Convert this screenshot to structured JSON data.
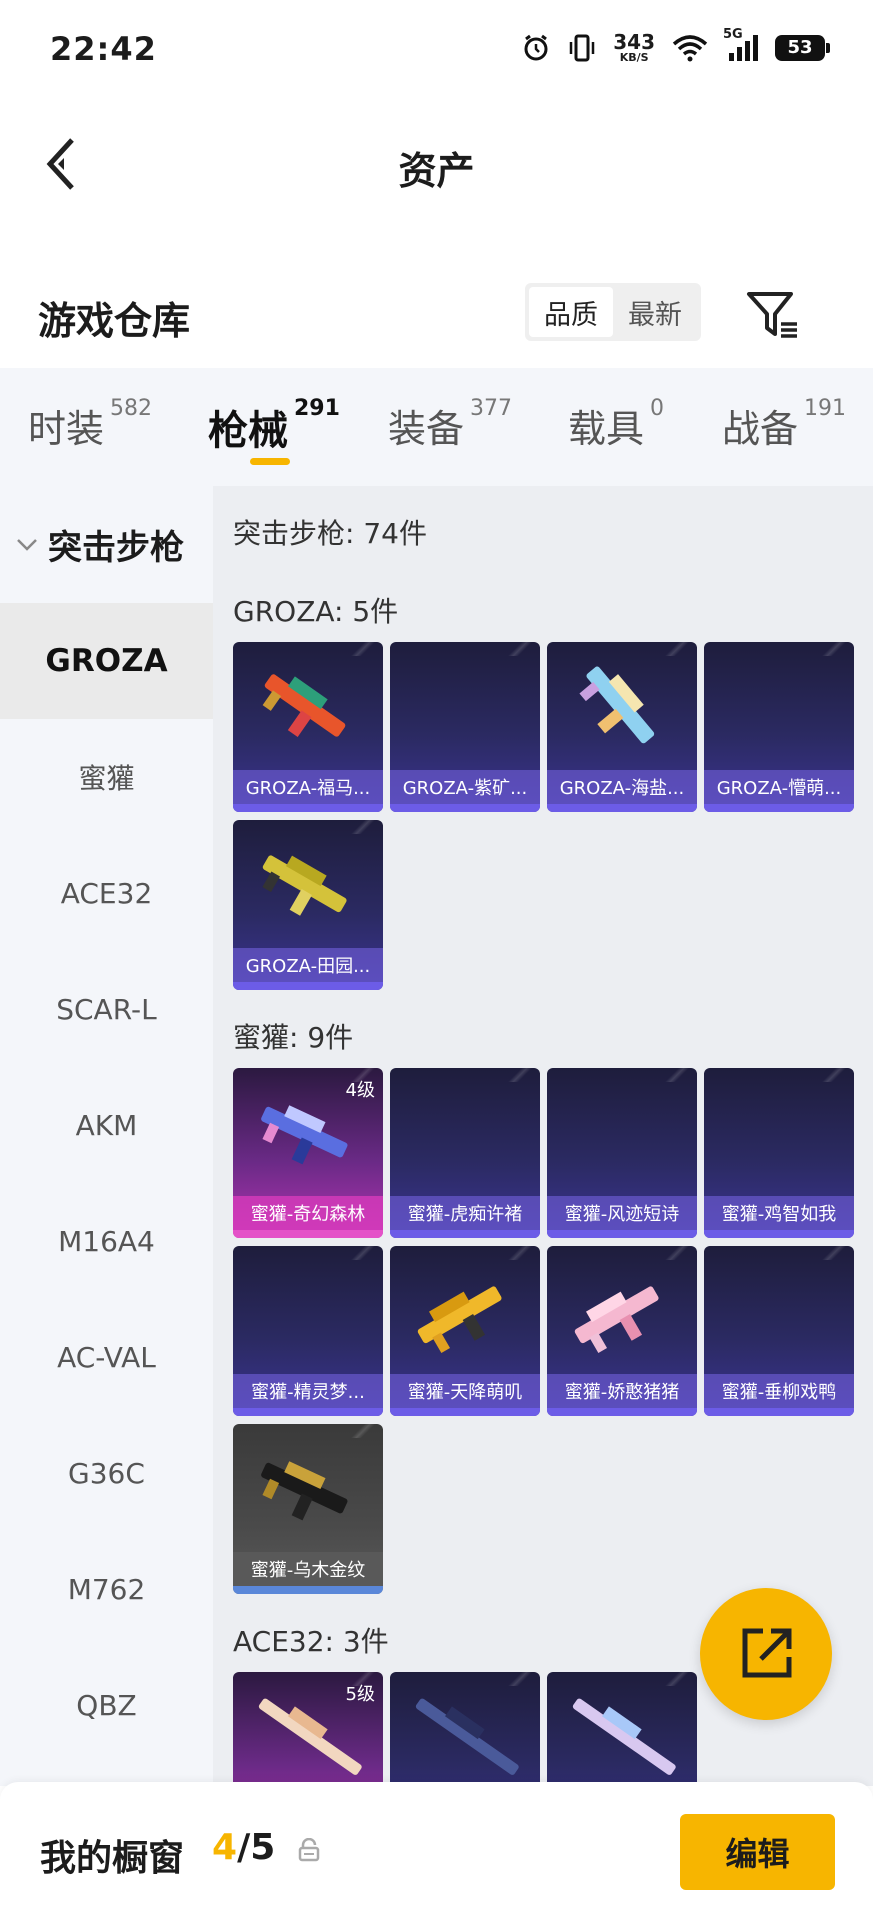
{
  "status_bar": {
    "time": "22:42",
    "net_speed": "343",
    "net_unit": "KB/S",
    "network_type": "5G",
    "battery": "53",
    "icons": [
      "alarm-icon",
      "vibrate-icon",
      "wifi-icon",
      "signal-icon",
      "battery-icon"
    ]
  },
  "header": {
    "title": "资产",
    "back_icon": "chevron-left-icon"
  },
  "warehouse": {
    "title": "游戏仓库",
    "sort_options": [
      "品质",
      "最新"
    ],
    "active_sort": "品质",
    "filter_icon": "filter-icon"
  },
  "category_tabs": [
    {
      "label": "时装",
      "count": "582"
    },
    {
      "label": "枪械",
      "count": "291",
      "active": true
    },
    {
      "label": "装备",
      "count": "377"
    },
    {
      "label": "载具",
      "count": "0"
    },
    {
      "label": "战备",
      "count": "191"
    }
  ],
  "left_nav": {
    "header": "突击步枪",
    "items": [
      "GROZA",
      "蜜獾",
      "ACE32",
      "SCAR-L",
      "AKM",
      "M16A4",
      "AC-VAL",
      "G36C",
      "M762",
      "QBZ"
    ],
    "active": "GROZA"
  },
  "content": {
    "summary": "突击步枪: 74件",
    "sections": [
      {
        "title": "GROZA: 5件",
        "cards": [
          {
            "label": "GROZA-福马...",
            "level": "",
            "rarity": "purple"
          },
          {
            "label": "GROZA-紫矿...",
            "level": "",
            "rarity": "purple"
          },
          {
            "label": "GROZA-海盐...",
            "level": "",
            "rarity": "purple"
          },
          {
            "label": "GROZA-懵萌...",
            "level": "",
            "rarity": "purple"
          },
          {
            "label": "GROZA-田园...",
            "level": "",
            "rarity": "purple"
          }
        ]
      },
      {
        "title": "蜜獾: 9件",
        "cards": [
          {
            "label": "蜜獾-奇幻森林",
            "level": "4级",
            "rarity": "pink"
          },
          {
            "label": "蜜獾-虎痴许褚",
            "level": "",
            "rarity": "purple"
          },
          {
            "label": "蜜獾-风迹短诗",
            "level": "",
            "rarity": "purple"
          },
          {
            "label": "蜜獾-鸡智如我",
            "level": "",
            "rarity": "purple"
          },
          {
            "label": "蜜獾-精灵梦...",
            "level": "",
            "rarity": "purple"
          },
          {
            "label": "蜜獾-天降萌叽",
            "level": "",
            "rarity": "purple"
          },
          {
            "label": "蜜獾-娇憨猪猪",
            "level": "",
            "rarity": "purple"
          },
          {
            "label": "蜜獾-垂柳戏鸭",
            "level": "",
            "rarity": "purple"
          },
          {
            "label": "蜜獾-乌木金纹",
            "level": "",
            "rarity": "gray"
          }
        ]
      },
      {
        "title": "ACE32: 3件",
        "cards": [
          {
            "label": "",
            "level": "5级",
            "rarity": "pink"
          },
          {
            "label": "",
            "level": "",
            "rarity": "purple"
          },
          {
            "label": "",
            "level": "",
            "rarity": "purple"
          }
        ]
      }
    ]
  },
  "fab": {
    "icon": "share-external-icon"
  },
  "bottom_bar": {
    "title": "我的橱窗",
    "current": "4",
    "separator": "/",
    "total": "5",
    "lock_icon": "lock-icon",
    "edit_label": "编辑"
  },
  "colors": {
    "accent": "#f7b500",
    "card_purple": "#2b2a62",
    "card_pink": "#b133b0",
    "card_gray": "#4a4a4a"
  }
}
